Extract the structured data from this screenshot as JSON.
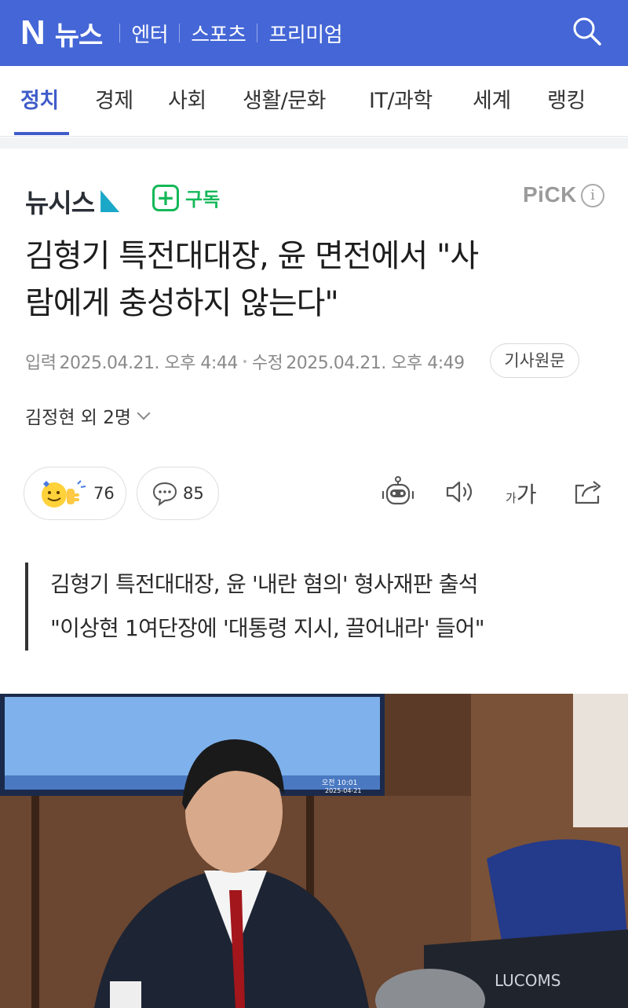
{
  "topbar": {
    "logo_n": "N",
    "logo_label": "뉴스",
    "menu": [
      "엔터",
      "스포츠",
      "프리미엄"
    ],
    "bg_color": "#4466d6"
  },
  "categories": {
    "items": [
      "정치",
      "경제",
      "사회",
      "생활/문화",
      "IT/과학",
      "세계",
      "랭킹"
    ],
    "active_index": 0,
    "accent_color": "#3f5cc9"
  },
  "press": {
    "name": "뉴시스",
    "subscribe_label": "구독",
    "pick_label": "PiCK",
    "info_icon": "i"
  },
  "article": {
    "headline_line1": "김형기 특전대대장, 윤 면전에서 \"사",
    "headline_line2": "람에게 충성하지 않는다\"",
    "input_label": "입력",
    "input_time": "2025.04.21. 오후 4:44",
    "modified_label": "수정",
    "modified_time": "2025.04.21. 오후 4:49",
    "original_button": "기사원문",
    "reporter": "김정현 외 2명",
    "summary": [
      "김형기 특전대대장, 윤 '내란 혐의' 형사재판 출석",
      "\"이상현 1여단장에 '대통령 지시, 끌어내라' 들어\""
    ]
  },
  "reactions": {
    "like_count": "76",
    "comment_count": "85"
  },
  "toolbar": {
    "font_small": "가",
    "font_big": "가"
  },
  "photo": {
    "screen_time": "오전 10:01",
    "screen_date": "2025-04-21",
    "monitor_brand": "LUCOMS"
  }
}
